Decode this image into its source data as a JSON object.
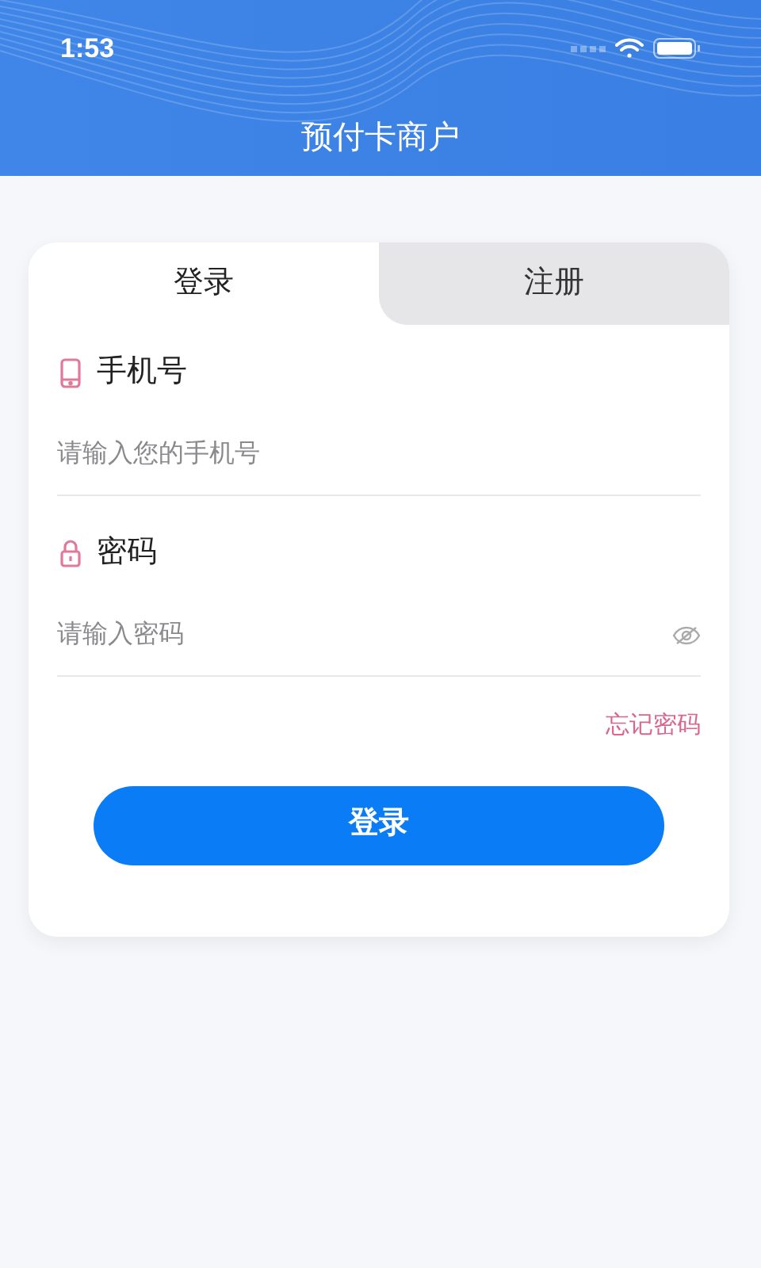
{
  "status_bar": {
    "time": "1:53"
  },
  "header": {
    "title": "预付卡商户"
  },
  "tabs": [
    {
      "label": "登录",
      "selected": true
    },
    {
      "label": "注册",
      "selected": false
    }
  ],
  "fields": [
    {
      "kind": "phone",
      "label": "手机号",
      "placeholder": "请输入您的手机号"
    },
    {
      "kind": "password",
      "label": "密码",
      "placeholder": "请输入密码"
    }
  ],
  "forgot_link": "忘记密码",
  "submit_button": "登录"
}
